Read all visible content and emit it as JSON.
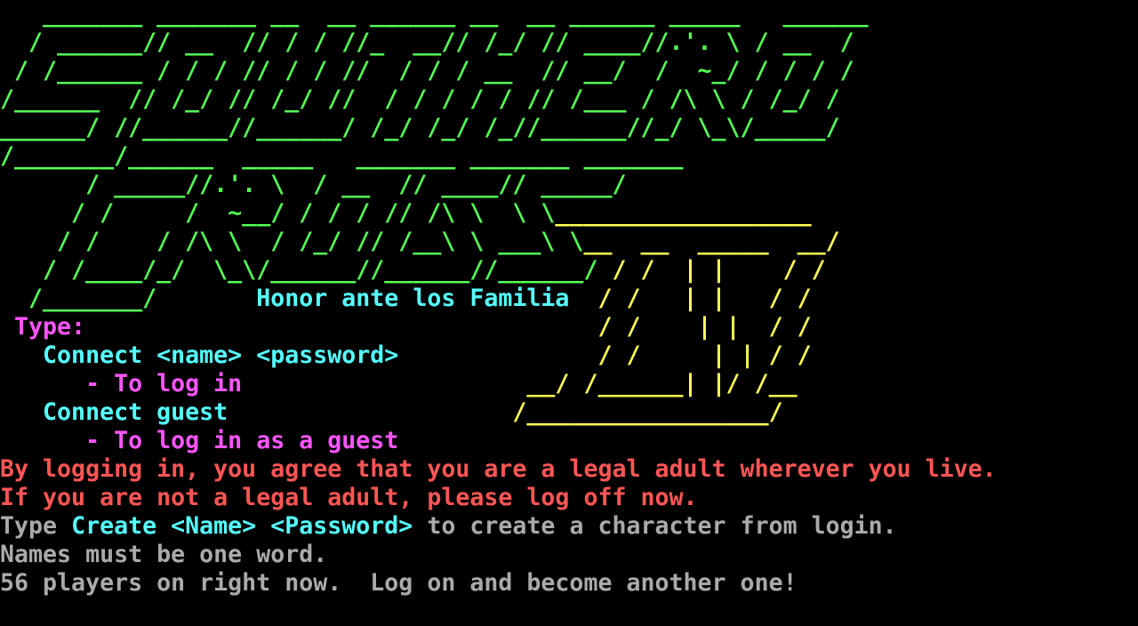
{
  "window": {
    "kind": "terminal",
    "background": "#000000"
  },
  "colors": {
    "green": "#55ff55",
    "yellow": "#ffff55",
    "cyan": "#55ffff",
    "magenta": "#ff55ff",
    "red": "#ff5555",
    "gray": "#aaaaaa"
  },
  "banner": {
    "art_lines": [
      [
        {
          "text": "   _______ _______ __  __ ______ __  __ ______ _____   ______",
          "color": "green"
        }
      ],
      [
        {
          "text": "  / ______// __  // / / //_  __// /_/ // ____//.'. \\ / __  /",
          "color": "green"
        }
      ],
      [
        {
          "text": " / /______ / / / // / / //  / / / __  // __/  /  ~_/ / / / /",
          "color": "green"
        }
      ],
      [
        {
          "text": "/______  // /_/ // /_/ //  / / / / / // /___ / /\\ \\ / /_/ /",
          "color": "green"
        }
      ],
      [
        {
          "text": "______/ //______//______/ /_/ /_/ /_//______//_/ \\_\\/_____/",
          "color": "green"
        }
      ],
      [
        {
          "text": "/_______/______  _____   _______ _______ _______",
          "color": "green"
        }
      ],
      [
        {
          "text": "      / _____//.'. \\  / __  // ____// _____/",
          "color": "green"
        }
      ],
      [
        {
          "text": "     / /     /  ~__/ / / / // /\\ \\  \\ \\",
          "color": "green"
        },
        {
          "text": "__________________",
          "color": "yellow"
        }
      ],
      [
        {
          "text": "    / /    / /\\ \\  / /_/ // /__\\ \\ ___\\ \\",
          "color": "green"
        },
        {
          "text": "__  __  _____  __/",
          "color": "yellow"
        }
      ],
      [
        {
          "text": "   / /____/_/  \\_\\/______//______//______/",
          "color": "green"
        },
        {
          "text": " / /  | |    / /",
          "color": "yellow"
        }
      ],
      [
        {
          "text": "  /_______/       ",
          "color": "green"
        },
        {
          "text": "Honor ante los Familia",
          "color": "cyan"
        },
        {
          "text": "  / /   | |   / /",
          "color": "yellow"
        }
      ]
    ]
  },
  "instructions": {
    "lines": [
      [
        {
          "text": " Type:",
          "color": "magenta"
        },
        {
          "text": "                                    / /    | |  / /",
          "color": "yellow"
        }
      ],
      [
        {
          "text": "   Connect <name> <password>",
          "color": "cyan"
        },
        {
          "text": "              / /     | | / /",
          "color": "yellow"
        }
      ],
      [
        {
          "text": "      - To log in",
          "color": "magenta"
        },
        {
          "text": "                    __/ /______| |/ /__",
          "color": "yellow"
        }
      ],
      [
        {
          "text": "   Connect guest",
          "color": "cyan"
        },
        {
          "text": "                    /_________________/",
          "color": "yellow"
        }
      ],
      [
        {
          "text": "      - To log in as a guest",
          "color": "magenta"
        }
      ]
    ]
  },
  "notices": {
    "lines": [
      [
        {
          "text": "By logging in, you agree that you are a legal adult wherever you live.",
          "color": "red"
        }
      ],
      [
        {
          "text": "If you are not a legal adult, please log off now.",
          "color": "red"
        }
      ],
      [
        {
          "text": "Type ",
          "color": "gray"
        },
        {
          "text": "Create <Name> <Password>",
          "color": "cyan"
        },
        {
          "text": " to create a character from login.",
          "color": "gray"
        }
      ],
      [
        {
          "text": "Names must be one word.",
          "color": "gray"
        }
      ],
      [
        {
          "text": "56 players on right now.  Log on and become another one!",
          "color": "gray"
        }
      ]
    ]
  }
}
